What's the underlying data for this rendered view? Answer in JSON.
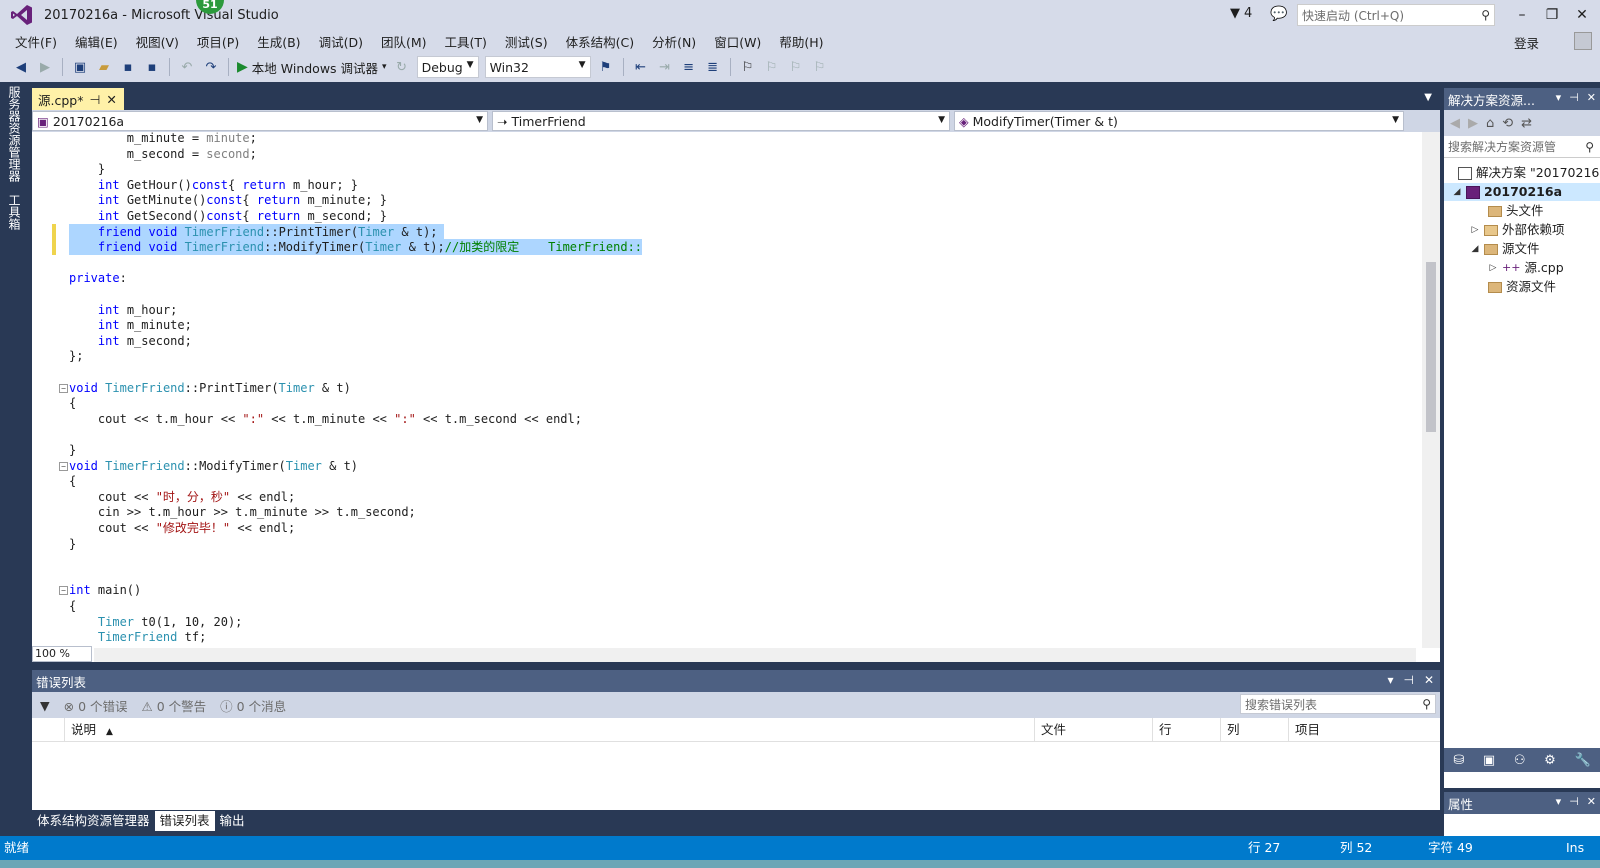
{
  "title_bar": {
    "title": "20170216a - Microsoft Visual Studio",
    "notification_count": "51",
    "flag_count": "4",
    "quick_launch_placeholder": "快速启动 (Ctrl+Q)",
    "minimize": "–",
    "restore": "❐",
    "close": "✕"
  },
  "menu": {
    "items": [
      "文件(F)",
      "编辑(E)",
      "视图(V)",
      "项目(P)",
      "生成(B)",
      "调试(D)",
      "团队(M)",
      "工具(T)",
      "测试(S)",
      "体系结构(C)",
      "分析(N)",
      "窗口(W)",
      "帮助(H)"
    ],
    "login": "登录"
  },
  "toolbar": {
    "run_label": "本地 Windows 调试器",
    "config": "Debug",
    "platform": "Win32"
  },
  "left_strip": {
    "tab1": "服务器资源管理器",
    "tab2": "工具箱"
  },
  "editor": {
    "tab_label": "源.cpp*",
    "tab_pin": "⊣",
    "tab_close": "✕",
    "nav_project": "20170216a",
    "nav_class": "TimerFriend",
    "nav_member": "ModifyTimer(Timer & t)",
    "zoom": "100 %"
  },
  "error_list": {
    "title": "错误列表",
    "errors": "0 个错误",
    "warnings": "0 个警告",
    "messages": "0 个消息",
    "search_placeholder": "搜索错误列表",
    "columns": [
      "说明",
      "文件",
      "行",
      "列",
      "项目"
    ]
  },
  "bottom_tabs": [
    "体系结构资源管理器",
    "错误列表",
    "输出"
  ],
  "solution_explorer": {
    "title": "解决方案资源...",
    "search_placeholder": "搜索解决方案资源管",
    "tree": [
      {
        "label": "解决方案 \"20170216",
        "level": 0
      },
      {
        "label": "20170216a",
        "level": 1
      },
      {
        "label": "头文件",
        "level": 2
      },
      {
        "label": "外部依赖项",
        "level": 2
      },
      {
        "label": "源文件",
        "level": 2
      },
      {
        "label": "源.cpp",
        "level": 3
      },
      {
        "label": "资源文件",
        "level": 2
      }
    ]
  },
  "properties": {
    "title": "属性"
  },
  "status_bar": {
    "state": "就绪",
    "row": "行 27",
    "col": "列 52",
    "char": "字符 49",
    "ins": "Ins"
  },
  "colors": {
    "chrome": "#d6dbe9",
    "frame": "#293955",
    "status": "#007acc",
    "selection": "#add6ff",
    "keyword": "#0000ff",
    "type": "#2b91af",
    "string": "#a31515",
    "comment": "#008000"
  },
  "code_lines": [
    "        m_minute = minute;",
    "        m_second = second;",
    "    }",
    "    int GetHour()const{ return m_hour; }",
    "    int GetMinute()const{ return m_minute; }",
    "    int GetSecond()const{ return m_second; }",
    "    friend void TimerFriend::PrintTimer(Timer & t);",
    "    friend void TimerFriend::ModifyTimer(Timer & t);//加类的限定    TimerFriend::",
    "",
    "private:",
    "",
    "    int m_hour;",
    "    int m_minute;",
    "    int m_second;",
    "};",
    "",
    "void TimerFriend::PrintTimer(Timer & t)",
    "{",
    "    cout << t.m_hour << \":\" << t.m_minute << \":\" << t.m_second << endl;",
    "",
    "}",
    "void TimerFriend::ModifyTimer(Timer & t)",
    "{",
    "    cout << \"时，分，秒\" << endl;",
    "    cin >> t.m_hour >> t.m_minute >> t.m_second;",
    "    cout << \"修改完毕！\" << endl;",
    "}",
    "",
    "",
    "int main()",
    "{",
    "    Timer t0(1, 10, 20);",
    "    TimerFriend tf;"
  ]
}
